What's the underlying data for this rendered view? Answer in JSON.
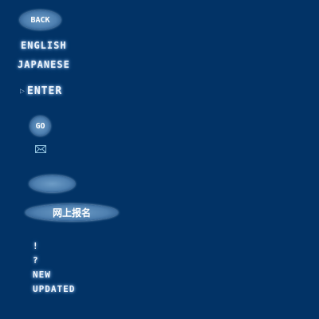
{
  "back_button": "BACK",
  "languages": [
    "ENGLISH",
    "JAPANESE"
  ],
  "enter": "ENTER",
  "go_button": "GO",
  "register_button": "网上报名",
  "labels": [
    "!",
    "?",
    "NEW",
    "UPDATED"
  ]
}
